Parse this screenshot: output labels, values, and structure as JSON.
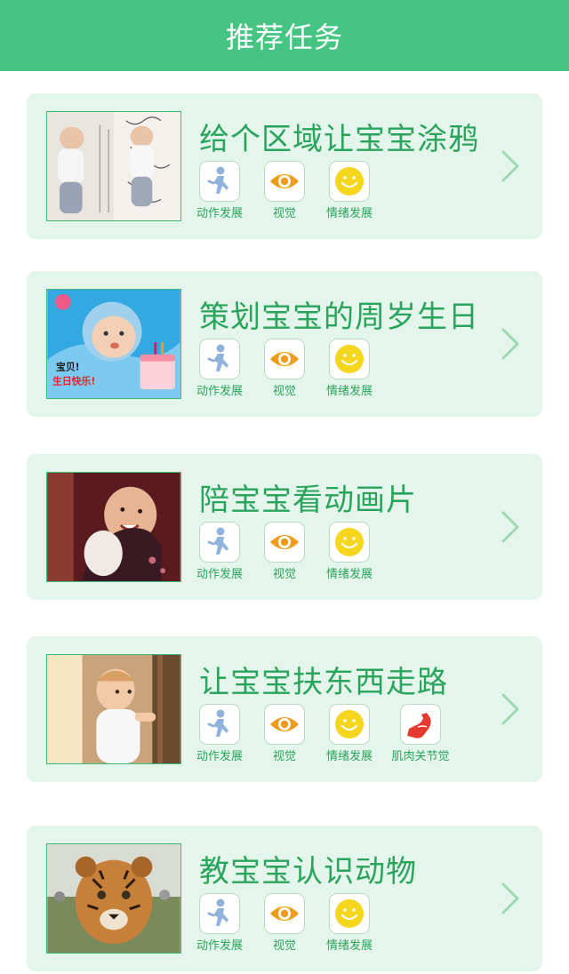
{
  "header": {
    "title": "推荐任务"
  },
  "colors": {
    "header_bg": "#45c482",
    "card_bg": "#e4f6eb",
    "accent_text": "#2aa45c",
    "chevron": "#9fd6b3"
  },
  "tasks": [
    {
      "title": "给个区域让宝宝涂鸦",
      "image": "baby-drawing-photo",
      "tags": [
        {
          "label": "动作发展",
          "icon": "running-figure-icon"
        },
        {
          "label": "视觉",
          "icon": "eye-icon"
        },
        {
          "label": "情绪发展",
          "icon": "smiley-face-icon"
        }
      ]
    },
    {
      "title": "策划宝宝的周岁生日",
      "image": "baby-birthday-cake-photo",
      "image_caption": "宝贝!生日快乐!",
      "tags": [
        {
          "label": "动作发展",
          "icon": "running-figure-icon"
        },
        {
          "label": "视觉",
          "icon": "eye-icon"
        },
        {
          "label": "情绪发展",
          "icon": "smiley-face-icon"
        }
      ]
    },
    {
      "title": "陪宝宝看动画片",
      "image": "baby-smiling-photo",
      "tags": [
        {
          "label": "动作发展",
          "icon": "running-figure-icon"
        },
        {
          "label": "视觉",
          "icon": "eye-icon"
        },
        {
          "label": "情绪发展",
          "icon": "smiley-face-icon"
        }
      ]
    },
    {
      "title": "让宝宝扶东西走路",
      "image": "baby-holding-door-photo",
      "tags": [
        {
          "label": "动作发展",
          "icon": "running-figure-icon"
        },
        {
          "label": "视觉",
          "icon": "eye-icon"
        },
        {
          "label": "情绪发展",
          "icon": "smiley-face-icon"
        },
        {
          "label": "肌肉关节觉",
          "icon": "flexed-arm-icon"
        }
      ]
    },
    {
      "title": "教宝宝认识动物",
      "image": "tiger-cub-photo",
      "tags": [
        {
          "label": "动作发展",
          "icon": "running-figure-icon"
        },
        {
          "label": "视觉",
          "icon": "eye-icon"
        },
        {
          "label": "情绪发展",
          "icon": "smiley-face-icon"
        }
      ]
    }
  ]
}
